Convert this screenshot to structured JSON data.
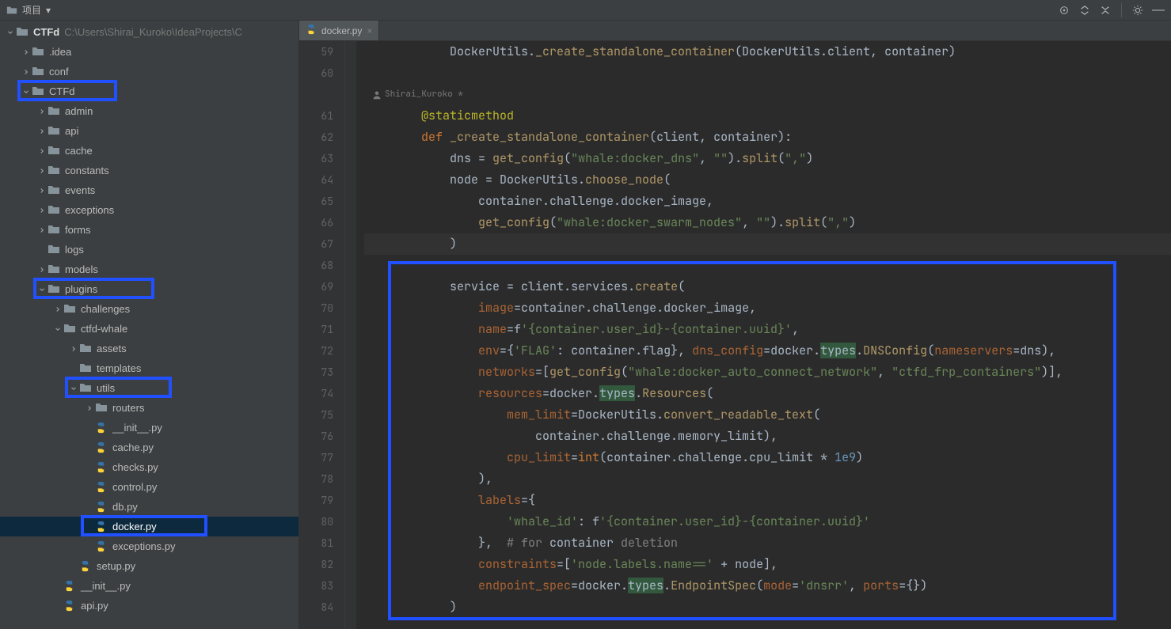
{
  "topbar": {
    "project_label": "项目",
    "dropdown_glyph": "▾"
  },
  "tab": {
    "filename": "docker.py",
    "close_glyph": "×"
  },
  "sidebar": {
    "root": {
      "name": "CTFd",
      "path": "C:\\Users\\Shirai_Kuroko\\IdeaProjects\\C"
    },
    "items": [
      {
        "depth": 0,
        "expanded": true,
        "kind": "root"
      },
      {
        "depth": 1,
        "expanded": false,
        "kind": "folder",
        "name": ".idea"
      },
      {
        "depth": 1,
        "expanded": false,
        "kind": "folder",
        "name": "conf"
      },
      {
        "depth": 1,
        "expanded": true,
        "kind": "folder",
        "name": "CTFd",
        "boxed": true
      },
      {
        "depth": 2,
        "expanded": false,
        "kind": "folder",
        "name": "admin"
      },
      {
        "depth": 2,
        "expanded": false,
        "kind": "folder",
        "name": "api"
      },
      {
        "depth": 2,
        "expanded": false,
        "kind": "folder",
        "name": "cache"
      },
      {
        "depth": 2,
        "expanded": false,
        "kind": "folder",
        "name": "constants"
      },
      {
        "depth": 2,
        "expanded": false,
        "kind": "folder",
        "name": "events"
      },
      {
        "depth": 2,
        "expanded": false,
        "kind": "folder",
        "name": "exceptions"
      },
      {
        "depth": 2,
        "expanded": false,
        "kind": "folder",
        "name": "forms"
      },
      {
        "depth": 2,
        "expanded": null,
        "kind": "folder",
        "name": "logs"
      },
      {
        "depth": 2,
        "expanded": false,
        "kind": "folder",
        "name": "models"
      },
      {
        "depth": 2,
        "expanded": true,
        "kind": "folder",
        "name": "plugins",
        "boxed": true
      },
      {
        "depth": 3,
        "expanded": false,
        "kind": "folder",
        "name": "challenges"
      },
      {
        "depth": 3,
        "expanded": true,
        "kind": "folder",
        "name": "ctfd-whale"
      },
      {
        "depth": 4,
        "expanded": false,
        "kind": "folder",
        "name": "assets"
      },
      {
        "depth": 4,
        "expanded": null,
        "kind": "folder",
        "name": "templates"
      },
      {
        "depth": 4,
        "expanded": true,
        "kind": "folder",
        "name": "utils",
        "boxed": true
      },
      {
        "depth": 5,
        "expanded": false,
        "kind": "folder",
        "name": "routers"
      },
      {
        "depth": 5,
        "expanded": null,
        "kind": "py",
        "name": "__init__.py"
      },
      {
        "depth": 5,
        "expanded": null,
        "kind": "py",
        "name": "cache.py"
      },
      {
        "depth": 5,
        "expanded": null,
        "kind": "py",
        "name": "checks.py"
      },
      {
        "depth": 5,
        "expanded": null,
        "kind": "py",
        "name": "control.py"
      },
      {
        "depth": 5,
        "expanded": null,
        "kind": "py",
        "name": "db.py"
      },
      {
        "depth": 5,
        "expanded": null,
        "kind": "py",
        "name": "docker.py",
        "selected": true,
        "boxed": true
      },
      {
        "depth": 5,
        "expanded": null,
        "kind": "py",
        "name": "exceptions.py"
      },
      {
        "depth": 4,
        "expanded": null,
        "kind": "py",
        "name": "setup.py"
      },
      {
        "depth": 3,
        "expanded": null,
        "kind": "py",
        "name": "__init__.py"
      },
      {
        "depth": 3,
        "expanded": null,
        "kind": "py",
        "name": "api.py"
      }
    ]
  },
  "editor": {
    "author": "Shirai_Kuroko *",
    "line_numbers": [
      59,
      60,
      "",
      61,
      62,
      63,
      64,
      65,
      66,
      67,
      68,
      69,
      70,
      71,
      72,
      73,
      74,
      75,
      76,
      77,
      78,
      79,
      80,
      81,
      82,
      83,
      84
    ],
    "code_lines": [
      {
        "t": "            DockerUtils._create_standalone_container(DockerUtils.client, container)"
      },
      {
        "t": ""
      },
      {
        "author": true
      },
      {
        "t": "        @staticmethod"
      },
      {
        "t": "        def _create_standalone_container(client, container):"
      },
      {
        "t": "            dns = get_config(\"whale:docker_dns\", \"\").split(\",\")"
      },
      {
        "t": "            node = DockerUtils.choose_node("
      },
      {
        "t": "                container.challenge.docker_image,"
      },
      {
        "t": "                get_config(\"whale:docker_swarm_nodes\", \"\").split(\",\")"
      },
      {
        "t": "            )"
      },
      {
        "t": ""
      },
      {
        "t": "            service = client.services.create("
      },
      {
        "t": "                image=container.challenge.docker_image,"
      },
      {
        "t": "                name=f'{container.user_id}-{container.uuid}',"
      },
      {
        "t": "                env={'FLAG': container.flag}, dns_config=docker.types.DNSConfig(nameservers=dns),"
      },
      {
        "t": "                networks=[get_config(\"whale:docker_auto_connect_network\", \"ctfd_frp_containers\")],"
      },
      {
        "t": "                resources=docker.types.Resources("
      },
      {
        "t": "                    mem_limit=DockerUtils.convert_readable_text("
      },
      {
        "t": "                        container.challenge.memory_limit),"
      },
      {
        "t": "                    cpu_limit=int(container.challenge.cpu_limit * 1e9)"
      },
      {
        "t": "                ),"
      },
      {
        "t": "                labels={"
      },
      {
        "t": "                    'whale_id': f'{container.user_id}-{container.uuid}'"
      },
      {
        "t": "                },  # for container deletion"
      },
      {
        "t": "                constraints=['node.labels.name==' + node],"
      },
      {
        "t": "                endpoint_spec=docker.types.EndpointSpec(mode='dnsrr', ports={})"
      },
      {
        "t": "            )"
      }
    ]
  },
  "chart_data": null
}
